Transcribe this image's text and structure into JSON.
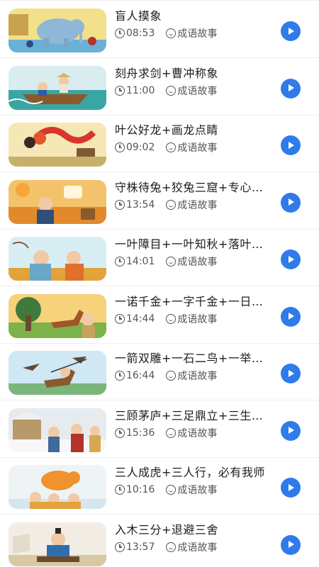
{
  "category_label": "成语故事",
  "colors": {
    "accent": "#2f7bea",
    "divider": "#efefef"
  },
  "stories": [
    {
      "title": "盲人摸象",
      "duration": "08:53",
      "thumb": "elephant"
    },
    {
      "title": "刻舟求剑+曹冲称象",
      "duration": "11:00",
      "thumb": "boat"
    },
    {
      "title": "叶公好龙+画龙点睛",
      "duration": "09:02",
      "thumb": "dragon"
    },
    {
      "title": "守株待兔+狡兔三窟+专心致志",
      "duration": "13:54",
      "thumb": "rabbit"
    },
    {
      "title": "一叶障目+一叶知秋+落叶归根",
      "duration": "14:01",
      "thumb": "leaf"
    },
    {
      "title": "一诺千金+一字千金+一日千里",
      "duration": "14:44",
      "thumb": "horse"
    },
    {
      "title": "一箭双雕+一石二鸟+一举两得",
      "duration": "16:44",
      "thumb": "arrow"
    },
    {
      "title": "三顾茅庐+三足鼎立+三生有幸",
      "duration": "15:36",
      "thumb": "snow"
    },
    {
      "title": "三人成虎+三人行，必有我师",
      "duration": "10:16",
      "thumb": "tiger"
    },
    {
      "title": "入木三分+退避三舍",
      "duration": "13:57",
      "thumb": "scholar"
    }
  ]
}
